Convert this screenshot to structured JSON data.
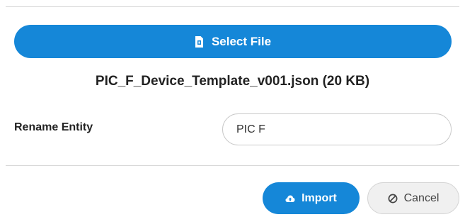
{
  "upload": {
    "select_file_label": "Select File",
    "select_file_icon": "file-icon",
    "file_name": "PIC_F_Device_Template_v001.json (20 KB)"
  },
  "rename": {
    "label": "Rename Entity",
    "value": "PIC F"
  },
  "footer": {
    "import_label": "Import",
    "import_icon": "cloud-upload-icon",
    "cancel_label": "Cancel",
    "cancel_icon": "ban-icon"
  },
  "colors": {
    "primary": "#1587d8",
    "secondary_bg": "#f0f0f0",
    "divider": "#d8d8d8"
  }
}
